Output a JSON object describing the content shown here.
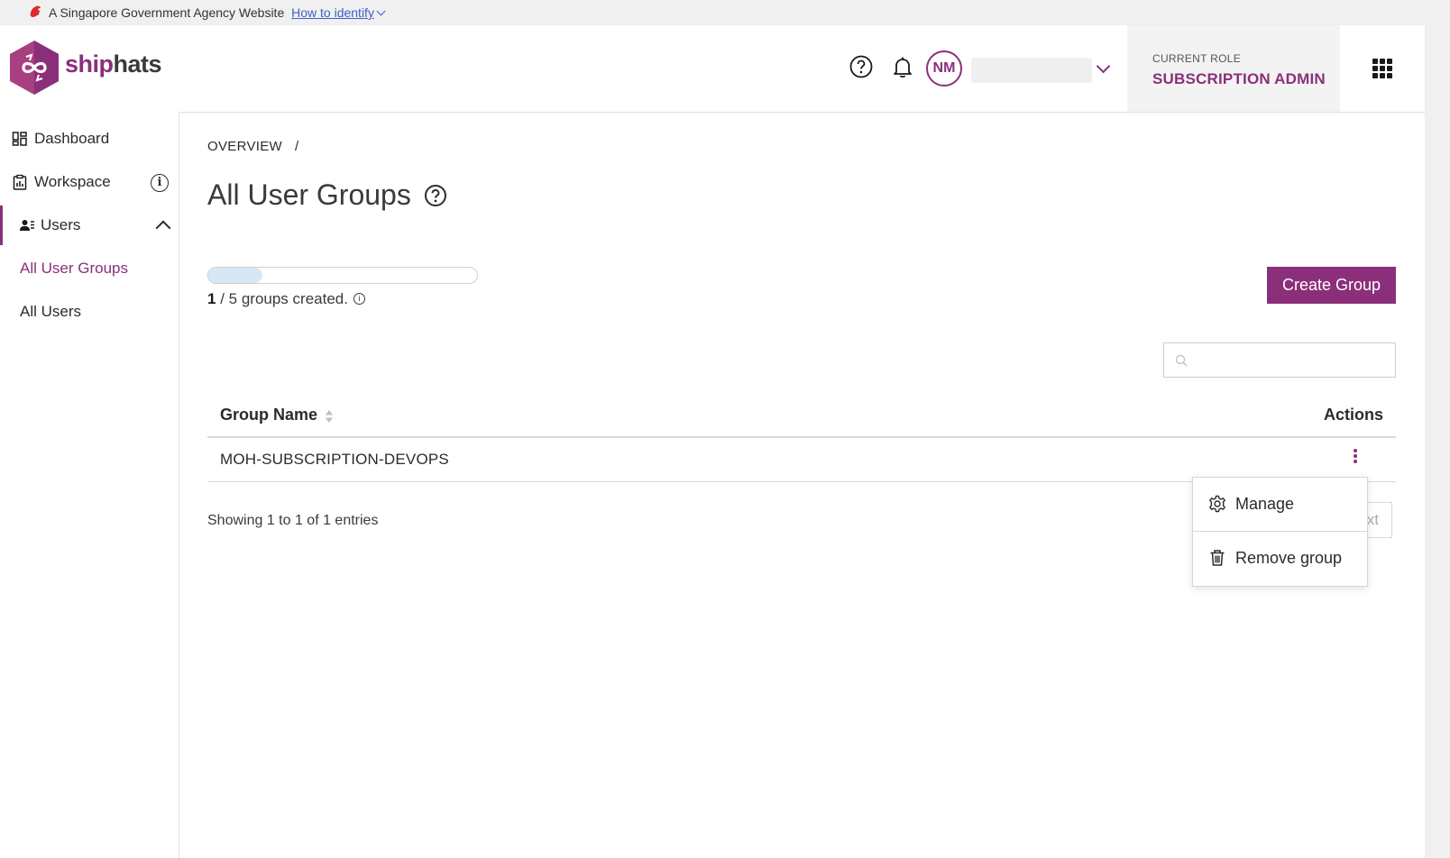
{
  "masthead": {
    "text": "A Singapore Government Agency Website",
    "link": "How to identify"
  },
  "header": {
    "brand_part1": "ship",
    "brand_part2": "hats",
    "avatar_initials": "NM",
    "role_label": "CURRENT ROLE",
    "role_value": "SUBSCRIPTION ADMIN"
  },
  "sidebar": {
    "items": [
      {
        "label": "Dashboard"
      },
      {
        "label": "Workspace"
      },
      {
        "label": "Users"
      }
    ],
    "sub_items": [
      {
        "label": "All User Groups"
      },
      {
        "label": "All Users"
      }
    ]
  },
  "main": {
    "breadcrumb": "OVERVIEW",
    "breadcrumb_sep": "/",
    "title": "All User Groups",
    "progress": {
      "created": 1,
      "total": 5,
      "created_label": "1",
      "rest_label": "/ 5 groups created."
    },
    "create_button": "Create Group",
    "search_placeholder": "",
    "table": {
      "headers": {
        "name": "Group Name",
        "actions": "Actions"
      },
      "rows": [
        {
          "name": "MOH-SUBSCRIPTION-DEVOPS"
        }
      ]
    },
    "entries_text": "Showing 1 to 1 of 1 entries",
    "next_partial": "xt",
    "dropdown": [
      {
        "label": "Manage",
        "icon": "gear-icon"
      },
      {
        "label": "Remove group",
        "icon": "trash-icon"
      }
    ]
  },
  "colors": {
    "accent": "#8b2f7b",
    "progress_fill": "#d6e8f5"
  }
}
